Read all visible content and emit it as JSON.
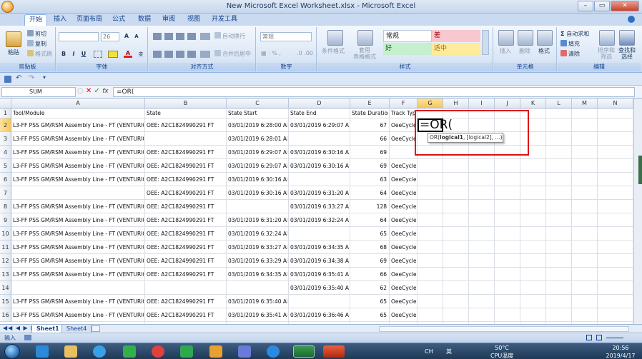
{
  "window": {
    "title": "New Microsoft Excel Worksheet.xlsx - Microsoft Excel",
    "minimize": "–",
    "restore": "▭",
    "close": "✕"
  },
  "tabs": [
    "开始",
    "插入",
    "页面布局",
    "公式",
    "数据",
    "审阅",
    "视图",
    "开发工具"
  ],
  "ribbon": {
    "clipboard": {
      "label": "剪贴板",
      "paste": "粘贴",
      "cut": "剪切",
      "copy": "复制",
      "format_painter": "格式刷"
    },
    "font": {
      "label": "字体",
      "font_name": "",
      "font_size": "26"
    },
    "alignment": {
      "label": "对齐方式",
      "wrap_text": "自动换行",
      "merge_center": "合并后居中"
    },
    "number": {
      "label": "数字",
      "format": "常规"
    },
    "styles": {
      "label": "样式",
      "conditional": "条件格式",
      "table_format": "套用\n表格格式",
      "cell_styles": [
        "常规",
        "差",
        "好",
        "适中"
      ]
    },
    "cells": {
      "label": "单元格",
      "insert": "插入",
      "delete": "删除",
      "format": "格式"
    },
    "editing": {
      "label": "编辑",
      "autosum": "自动求和",
      "fill": "填充",
      "clear": "清除",
      "sort_filter": "排序和\n筛选",
      "find_select": "查找和\n选择"
    }
  },
  "formula_bar": {
    "name_box": "SUM",
    "cancel": "✕",
    "enter": "✓",
    "fx": "fx",
    "formula": "=OR("
  },
  "columns": [
    "A",
    "B",
    "C",
    "D",
    "E",
    "F",
    "G",
    "H",
    "I",
    "J",
    "K",
    "L",
    "M",
    "N"
  ],
  "row_numbers": [
    "1",
    "2",
    "3",
    "4",
    "5",
    "6",
    "7",
    "8",
    "9",
    "10",
    "11",
    "12",
    "13",
    "14",
    "15",
    "16"
  ],
  "headers": [
    "Tool/Module",
    "State",
    "State Start",
    "State End",
    "State Duration",
    "Track Typ"
  ],
  "rows": [
    [
      "L3-FF PSS GM/RSM Assembly Line - FT (VENTURI049)",
      "OEE: A2C1824990291 FT",
      "03/01/2019 6:28:00 AM",
      "03/01/2019 6:29:07 AM",
      "67",
      "OeeCycle"
    ],
    [
      "L3-FF PSS GM/RSM Assembly Line - FT (VENTURI060)",
      "",
      "03/01/2019 6:28:01 AM",
      "",
      "66",
      "OeeCycle"
    ],
    [
      "L3-FF PSS GM/RSM Assembly Line - FT (VENTURI049)",
      "OEE: A2C1824990291 FT",
      "03/01/2019 6:29:07 AM",
      "03/01/2019 6:30:16 AM",
      "69",
      ""
    ],
    [
      "L3-FF PSS GM/RSM Assembly Line - FT (VENTURI060)",
      "OEE: A2C1824990291 FT",
      "03/01/2019 6:29:07 AM",
      "03/01/2019 6:30:16 AM",
      "69",
      "OeeCycle"
    ],
    [
      "L3-FF PSS GM/RSM Assembly Line - FT (VENTURI049)",
      "OEE: A2C1824990291 FT",
      "03/01/2019 6:30:16 AM",
      "",
      "63",
      "OeeCycle"
    ],
    [
      "",
      "OEE: A2C1824990291 FT",
      "03/01/2019 6:30:16 AM",
      "03/01/2019 6:31:20 AM",
      "64",
      "OeeCycle"
    ],
    [
      "L3-FF PSS GM/RSM Assembly Line - FT (VENTURI049)",
      "OEE: A2C1824990291 FT",
      "",
      "03/01/2019 6:33:27 AM",
      "128",
      "OeeCycle"
    ],
    [
      "L3-FF PSS GM/RSM Assembly Line - FT (VENTURI049)",
      "OEE: A2C1824990291 FT",
      "03/01/2019 6:31:20 AM",
      "03/01/2019 6:32:24 AM",
      "64",
      "OeeCycle"
    ],
    [
      "L3-FF PSS GM/RSM Assembly Line - FT (VENTURI060)",
      "OEE: A2C1824990291 FT",
      "03/01/2019 6:32:24 AM",
      "",
      "65",
      "OeeCycle"
    ],
    [
      "L3-FF PSS GM/RSM Assembly Line - FT (VENTURI049)",
      "OEE: A2C1824990291 FT",
      "03/01/2019 6:33:27 AM",
      "03/01/2019 6:34:35 AM",
      "68",
      "OeeCycle"
    ],
    [
      "L3-FF PSS GM/RSM Assembly Line - FT (VENTURI060)",
      "OEE: A2C1824990291 FT",
      "03/01/2019 6:33:29 AM",
      "03/01/2019 6:34:38 AM",
      "69",
      "OeeCycle"
    ],
    [
      "L3-FF PSS GM/RSM Assembly Line - FT (VENTURI049)",
      "OEE: A2C1824990291 FT",
      "03/01/2019 6:34:35 AM",
      "03/01/2019 6:35:41 AM",
      "66",
      "OeeCycle"
    ],
    [
      "",
      "",
      "",
      "03/01/2019 6:35:40 AM",
      "62",
      "OeeCycle"
    ],
    [
      "L3-FF PSS GM/RSM Assembly Line - FT (VENTURI049)",
      "OEE: A2C1824990291 FT",
      "03/01/2019 6:35:40 AM",
      "",
      "65",
      "OeeCycle"
    ],
    [
      "L3-FF PSS GM/RSM Assembly Line - FT (VENTURI060)",
      "OEE: A2C1824990291 FT",
      "03/01/2019 6:35:41 AM",
      "03/01/2019 6:36:46 AM",
      "65",
      "OeeCycle"
    ]
  ],
  "active_cell": {
    "content": "=OR("
  },
  "tooltip": {
    "prefix": "OR(",
    "bold_arg": "logical1",
    "rest": ", [logical2], ...)"
  },
  "sheets": [
    "Sheet1",
    "Sheet4"
  ],
  "status": {
    "mode": "输入"
  },
  "taskbar": {
    "lang": "CH",
    "ime": "英",
    "temp": "50°C",
    "temp_label": "CPU温度",
    "time": "20:56",
    "date": "2019/4/17"
  },
  "colors": {
    "accent": "#15428b",
    "highlight": "#e01010",
    "selected_header": "#f6c65a"
  }
}
